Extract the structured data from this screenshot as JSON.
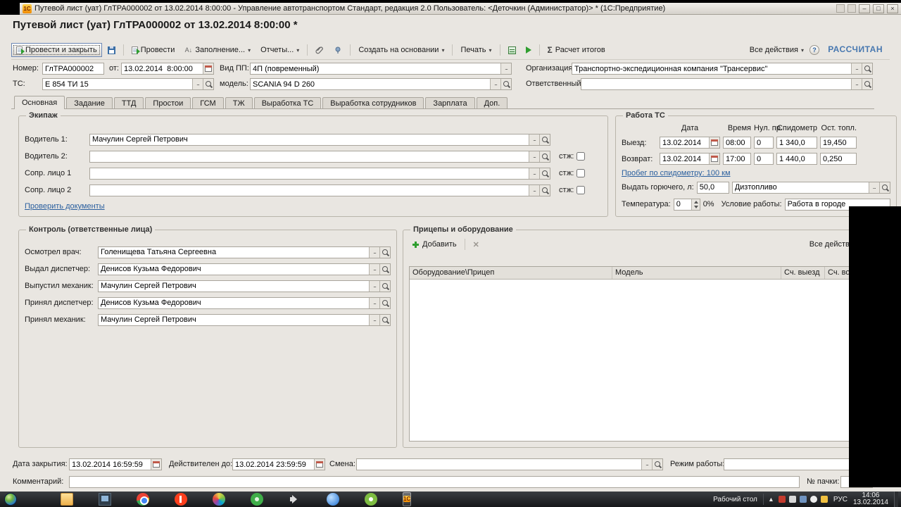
{
  "colors": {
    "accent_blue": "#4878b0",
    "link": "#2a5f9e",
    "form_bg": "#e9e6e1"
  },
  "glyphs": {
    "ellipsis": "...",
    "dropdown": "▾",
    "sigma": "Σ",
    "question": "?",
    "close": "✕",
    "minimize": "–",
    "maximize": "□",
    "x": "×",
    "chevron_up": "▴",
    "sort": "А↓"
  },
  "window": {
    "title": "Путевой лист (уат) ГлТРА000002 от 13.02.2014 8:00:00 - Управление автотранспортом Стандарт, редакция 2.0  Пользователь: <Деточкин (Администратор)> * (1С:Предприятие)",
    "onec_badge": "1С"
  },
  "form": {
    "title": "Путевой лист (уат) ГлТРА000002 от 13.02.2014 8:00:00 *",
    "status": "РАССЧИТАН"
  },
  "toolbar": {
    "post_close": "Провести и закрыть",
    "post": "Провести",
    "fill": "Заполнение...",
    "reports": "Отчеты...",
    "create_based": "Создать на основании",
    "print": "Печать",
    "totals": "Расчет итогов",
    "all_actions": "Все действия"
  },
  "fields": {
    "number_label": "Номер:",
    "number": "ГлТРА000002",
    "from_label": "от:",
    "datetime": "13.02.2014  8:00:00",
    "type_label": "Вид ПП:",
    "type": "4П (повременный)",
    "org_label": "Организация:",
    "org": "Транспортно-экспедиционная компания \"Трансервис\"",
    "vehicle_label": "ТС:",
    "vehicle": "Е 854 ТИ 15",
    "model_label": "модель:",
    "model": "SCANIA 94 D 260",
    "responsible_label": "Ответственный:",
    "responsible": ""
  },
  "tabs": [
    "Основная",
    "Задание",
    "ТТД",
    "Простои",
    "ГСМ",
    "ТЖ",
    "Выработка ТС",
    "Выработка сотрудников",
    "Зарплата",
    "Доп."
  ],
  "crew": {
    "title": "Экипаж",
    "stz_label": "стж:",
    "check_docs_link": "Проверить документы",
    "rows": [
      {
        "label": "Водитель 1:",
        "value": "Мачулин Сергей Петрович"
      },
      {
        "label": "Водитель 2:",
        "value": ""
      },
      {
        "label": "Сопр. лицо 1",
        "value": ""
      },
      {
        "label": "Сопр. лицо 2",
        "value": ""
      }
    ]
  },
  "work": {
    "title": "Работа ТС",
    "col_headers": [
      "Дата",
      "Время",
      "Нул. пр.",
      "Спидометр",
      "Ост. топл."
    ],
    "depart_label": "Выезд:",
    "return_label": "Возврат:",
    "depart": {
      "date": "13.02.2014",
      "time": "08:00",
      "nul": "0",
      "speedo": "1 340,0",
      "fuel": "19,450"
    },
    "ret": {
      "date": "13.02.2014",
      "time": "17:00",
      "nul": "0",
      "speedo": "1 440,0",
      "fuel": "0,250"
    },
    "mileage_link": "Пробег по спидометру: 100 км",
    "fuel_label": "Выдать горючего, л:",
    "fuel_qty": "50,0",
    "fuel_type": "Дизтопливо",
    "temp_label": "Температура:",
    "temp_value": "0",
    "temp_pct": "0%",
    "cond_label": "Условие работы:",
    "cond_value": "Работа в городе"
  },
  "control": {
    "title": "Контроль (ответственные лица)",
    "rows": [
      {
        "label": "Осмотрел врач:",
        "value": "Голенищева Татьяна Сергеевна"
      },
      {
        "label": "Выдал диспетчер:",
        "value": "Денисов Кузьма Федорович"
      },
      {
        "label": "Выпустил механик:",
        "value": "Мачулин Сергей Петрович"
      },
      {
        "label": "Принял диспетчер:",
        "value": "Денисов Кузьма Федорович"
      },
      {
        "label": "Принял механик:",
        "value": "Мачулин Сергей Петрович"
      }
    ]
  },
  "trailers": {
    "title": "Прицепы и оборудование",
    "add_label": "Добавить",
    "all_actions_label": "Все действия",
    "headers": [
      "Оборудование\\Прицеп",
      "Модель",
      "Сч. выезд",
      "Сч. возвр."
    ]
  },
  "footer": {
    "close_label": "Дата закрытия:",
    "close_value": "13.02.2014 16:59:59",
    "valid_label": "Действителен до:",
    "valid_value": "13.02.2014 23:59:59",
    "shift_label": "Смена:",
    "shift_value": "",
    "mode_label": "Режим работы:",
    "mode_value": "",
    "comment_label": "Комментарий:",
    "comment_value": "",
    "pack_label": "№ пачки:",
    "pack_value": ""
  },
  "taskbar": {
    "desktop_label": "Рабочий стол",
    "lang": "РУС",
    "time": "14:06",
    "date": "13.02.2014",
    "onec_label": "1С"
  }
}
